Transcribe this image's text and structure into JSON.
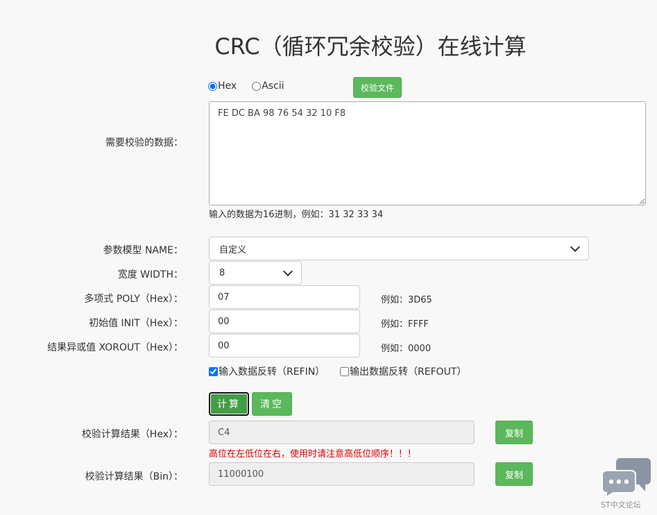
{
  "page": {
    "title": "CRC（循环冗余校验）在线计算"
  },
  "data_input": {
    "format_hex_label": "Hex",
    "format_ascii_label": "Ascii",
    "file_button_label": "校验文件",
    "label": "需要校验的数据：",
    "value": "FE DC BA 98 76 54 32 10 F8",
    "hint": "输入的数据为16进制，例如：31 32 33 34"
  },
  "params": {
    "name_label": "参数模型 NAME：",
    "name_value": "自定义",
    "width_label": "宽度 WIDTH：",
    "width_value": "8",
    "poly_label": "多项式 POLY（Hex）：",
    "poly_value": "07",
    "poly_example": "例如：3D65",
    "init_label": "初始值 INIT（Hex）：",
    "init_value": "00",
    "init_example": "例如：FFFF",
    "xorout_label": "结果异或值 XOROUT（Hex）：",
    "xorout_value": "00",
    "xorout_example": "例如：0000",
    "refin_label": "输入数据反转（REFIN）",
    "refin_checked": true,
    "refout_label": "输出数据反转（REFOUT）",
    "refout_checked": false
  },
  "actions": {
    "calculate_label": "计算",
    "clear_label": "清空"
  },
  "result": {
    "hex_label": "校验计算结果（Hex）：",
    "hex_value": "C4",
    "copy_label": "复制",
    "warning": "高位在左低位在右，使用时请注意高低位顺序！！！",
    "bin_label": "校验计算结果（Bin）：",
    "bin_value": "11000100"
  },
  "footer": {
    "site_label": "ST中文论坛",
    "chat_icon": "chat-bubbles-icon"
  },
  "colors": {
    "accent_green": "#5cb85c",
    "warning_red": "#dd0000"
  }
}
